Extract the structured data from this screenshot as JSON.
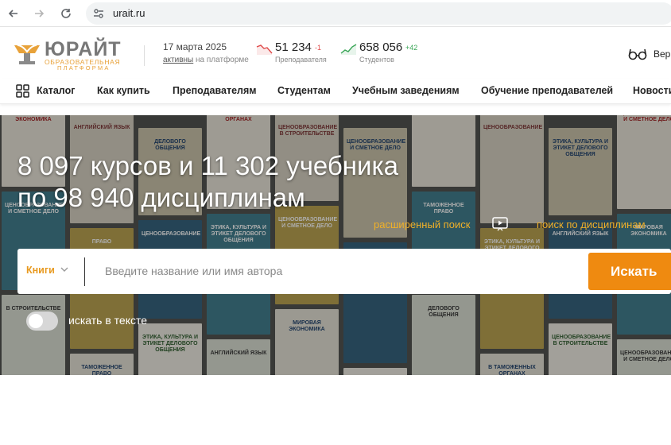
{
  "browser": {
    "url": "urait.ru"
  },
  "header": {
    "logo_name": "ЮРАЙТ",
    "logo_sub1": "ОБРАЗОВАТЕЛЬНАЯ",
    "logo_sub2": "ПЛАТФОРМА",
    "date": "17 марта 2025",
    "active_link": "активны",
    "active_rest": " на платформе",
    "teachers": {
      "value": "51 234",
      "delta": "-1",
      "label": "Преподавателя"
    },
    "students": {
      "value": "658 056",
      "delta": "+42",
      "label": "Студентов"
    },
    "version_label": "Вер"
  },
  "menu": {
    "items": [
      {
        "label": "Каталог"
      },
      {
        "label": "Как купить"
      },
      {
        "label": "Преподавателям"
      },
      {
        "label": "Студентам"
      },
      {
        "label": "Учебным заведениям"
      },
      {
        "label": "Обучение преподавателей"
      },
      {
        "label": "Новости"
      }
    ]
  },
  "hero": {
    "title_line1": "8 097 курсов и 11 302 учебника",
    "title_line2": "по 98 940 дисциплинам",
    "advanced_search": "расширенный поиск",
    "discipline_search": "поиск по дисциплинам",
    "search": {
      "type": "Книги",
      "placeholder": "Введите название или имя автора",
      "button": "Искать"
    },
    "toggle_label": "искать в тексте",
    "books": [
      "МИРОВАЯ ЭКОНОМИКА",
      "ЦЕНООБРАЗОВАНИЕ И СМЕТНОЕ ДЕЛО",
      "В СТРОИТЕЛЬСТВЕ",
      "АНГЛИЙСКИЙ ЯЗЫК",
      "ПРАВО",
      "ТАМОЖЕННОЕ ПРАВО",
      "ДЕЛОВОГО ОБЩЕНИЯ",
      "ЦЕНООБРАЗОВАНИЕ",
      "ЭТИКА, КУЛЬТУРА И ЭТИКЕТ ДЕЛОВОГО ОБЩЕНИЯ",
      "В ТАМОЖЕННЫХ ОРГАНАХ",
      "ЭТИКА, КУЛЬТУРА И ЭТИКЕТ ДЕЛОВОГО ОБЩЕНИЯ",
      "АНГЛИЙСКИЙ ЯЗЫК",
      "ЦЕНООБРАЗОВАНИЕ В СТРОИТЕЛЬСТВЕ",
      "ЦЕНООБРАЗОВАНИЕ И СМЕТНОЕ ДЕЛО"
    ]
  },
  "colors": {
    "accent": "#ef8a10",
    "link_yellow": "#f0b028",
    "logo_orange": "#e8a23a",
    "delta_down": "#e04b4b",
    "delta_up": "#3aa657"
  }
}
